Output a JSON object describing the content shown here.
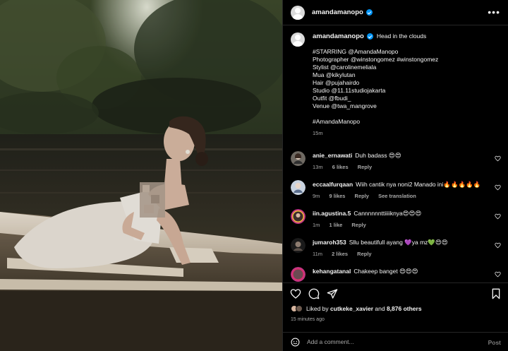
{
  "post": {
    "author": "amandamanopo",
    "title_text": "Head in the clouds",
    "caption_lines": [
      "#STARRING @AmandaManopo",
      "Photographer @winstongomez #winstongomez",
      "Stylist @carolinemeliala",
      "Mua @kikylutan",
      "Hair @pujahairdo",
      "Studio @11.11studiojakarta",
      "Outfit @fbudi_",
      "Venue @twa_mangrove"
    ],
    "hashtag": "#AmandaManopo",
    "caption_time": "15m"
  },
  "comments": [
    {
      "user": "anie_ernawati",
      "text": "Duh badass 😍😍",
      "time": "13m",
      "likes": "6 likes",
      "reply": "Reply",
      "extra": ""
    },
    {
      "user": "eccaalfurqaan",
      "text": "Wiih cantik nya noni2 Manado ini🔥🔥🔥🔥🔥",
      "time": "9m",
      "likes": "9 likes",
      "reply": "Reply",
      "extra": "See translation"
    },
    {
      "user": "iin.agustina.5",
      "text": "Cannnnnnttiiiiknya😍😍😍",
      "time": "1m",
      "likes": "1 like",
      "reply": "Reply",
      "extra": ""
    },
    {
      "user": "jumaroh353",
      "text": "Sllu beautifull ayang 💜ya mz💚😍😍",
      "time": "11m",
      "likes": "2 likes",
      "reply": "Reply",
      "extra": ""
    },
    {
      "user": "kehangatanal",
      "text": "Chakeep banget 😍😍😍",
      "time": "",
      "likes": "",
      "reply": "",
      "extra": ""
    }
  ],
  "likes": {
    "prefix": "Liked by",
    "user": "cutkeke_xavier",
    "middle": "and",
    "others": "8,876 others"
  },
  "posted_ago": "15 minutes ago",
  "add_comment": {
    "placeholder": "Add a comment...",
    "post_label": "Post"
  },
  "icons": [
    "more-icon",
    "verified-icon",
    "heart-icon",
    "comment-icon",
    "share-icon",
    "bookmark-icon",
    "emoji-icon"
  ],
  "colors": {
    "verified": "#0095f6",
    "background": "#000000",
    "secondary_text": "#a8a8a8"
  }
}
